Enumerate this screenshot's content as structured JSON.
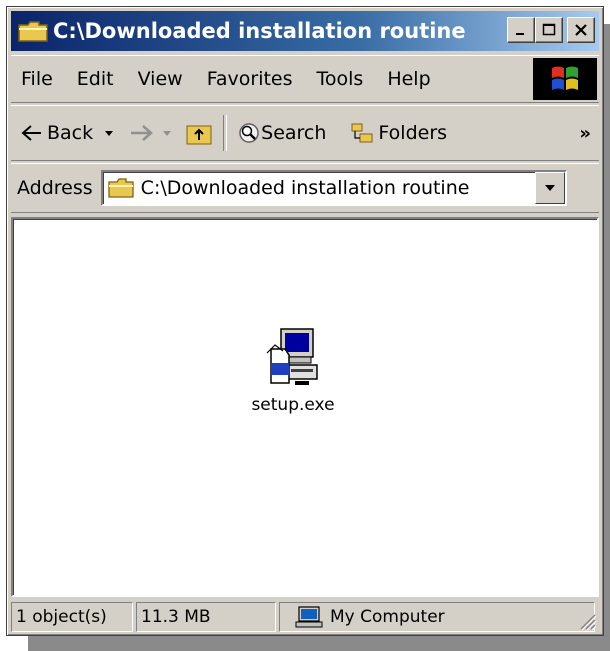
{
  "window": {
    "title": "C:\\Downloaded installation routine",
    "controls": {
      "minimize": "_",
      "maximize": "□",
      "close": "×"
    }
  },
  "menubar": {
    "items": [
      "File",
      "Edit",
      "View",
      "Favorites",
      "Tools",
      "Help"
    ]
  },
  "toolbar": {
    "back_label": "Back",
    "search_label": "Search",
    "folders_label": "Folders",
    "more_label": "»"
  },
  "address": {
    "label": "Address",
    "value": "C:\\Downloaded installation routine"
  },
  "content": {
    "files": [
      {
        "name": "setup.exe",
        "icon": "installer-icon"
      }
    ]
  },
  "statusbar": {
    "objects": "1 object(s)",
    "size": "11.3 MB",
    "zone": "My Computer"
  },
  "colors": {
    "title_start": "#0a246a",
    "title_end": "#a6caf0",
    "face": "#d4d0c8"
  }
}
